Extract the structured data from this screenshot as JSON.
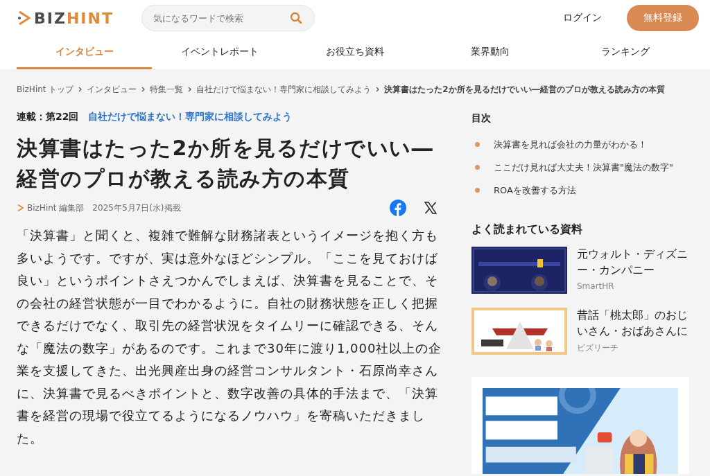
{
  "header": {
    "logo": "BIZHINT",
    "search": {
      "placeholder": "気になるワードで検索"
    },
    "login": "ログイン",
    "register": "無料登録"
  },
  "tabs": [
    {
      "label": "インタビュー",
      "selected": true
    },
    {
      "label": "イベントレポート",
      "selected": false
    },
    {
      "label": "お役立ち資料",
      "selected": false
    },
    {
      "label": "業界動向",
      "selected": false
    },
    {
      "label": "ランキング",
      "selected": false
    }
  ],
  "breadcrumb": [
    {
      "label": "BizHint トップ",
      "current": false
    },
    {
      "label": "インタビュー",
      "current": false
    },
    {
      "label": "特集一覧",
      "current": false
    },
    {
      "label": "自社だけで悩まない！専門家に相談してみよう",
      "current": false
    },
    {
      "label": "決算書はたった2か所を見るだけでいい―経営のプロが教える読み方の本質",
      "current": true
    }
  ],
  "article": {
    "series_label": "連載：第22回",
    "series_link": "自社だけで悩まない！専門家に相談してみよう",
    "title": "決算書はたった2か所を見るだけでいい―経営のプロが教える読み方の本質",
    "author": "BizHint 編集部",
    "date": "2025年5月7日(水)掲載",
    "body": "「決算書」と聞くと、複雑で難解な財務諸表というイメージを抱く方も多いようです。ですが、実は意外なほどシンプル。「ここを見ておけば良い」というポイントさえつかんでしまえば、決算書を見ることで、その会社の経営状態が一目でわかるように。自社の財務状態を正しく把握できるだけでなく、取引先の経営状況をタイムリーに確認できる、そんな「魔法の数字」があるのです。これまで30年に渡り1,000社以上の企業を支援してきた、出光興産出身の経営コンサルタント・石原尚幸さんに、決算書で見るべきポイントと、数字改善の具体的手法まで、「決算書を経営の現場で役立てるようになるノウハウ」を寄稿いただきました。"
  },
  "toc": {
    "title": "目次",
    "items": [
      "決算書を見れば会社の力量がわかる！",
      "ここだけ見れば大丈夫！決算書\"魔法の数字\"",
      "ROAを改善する方法"
    ]
  },
  "popular": {
    "title": "よく読まれている資料",
    "items": [
      {
        "title": "元ウォルト・ディズニー・カンパニー",
        "source": "SmartHR"
      },
      {
        "title": "昔話「桃太郎」のおじいさん・おばあさんに",
        "source": "ビズリーチ"
      }
    ]
  }
}
